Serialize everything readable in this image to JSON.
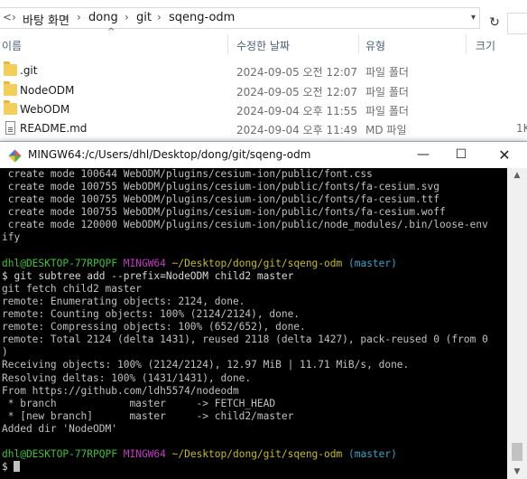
{
  "explorer": {
    "breadcrumb": [
      "바탕 화면",
      "dong",
      "git",
      "sqeng-odm"
    ],
    "columns": {
      "name": "이름",
      "modified": "수정한 날짜",
      "type": "유형",
      "size": "크기"
    },
    "files": [
      {
        "name": ".git",
        "modified": "2024-09-05 오전 12:07",
        "type": "파일 폴더",
        "size": "",
        "icon": "folder-icon"
      },
      {
        "name": "NodeODM",
        "modified": "2024-09-05 오전 12:07",
        "type": "파일 폴더",
        "size": "",
        "icon": "folder-icon"
      },
      {
        "name": "WebODM",
        "modified": "2024-09-04 오후 11:55",
        "type": "파일 폴더",
        "size": "",
        "icon": "folder-icon"
      },
      {
        "name": "README.md",
        "modified": "2024-09-04 오후 11:49",
        "type": "MD 파일",
        "size": "1K",
        "icon": "file-icon"
      }
    ]
  },
  "terminal": {
    "title": "MINGW64:/c/Users/dhl/Desktop/dong/git/sqeng-odm",
    "lines": [
      " create mode 100644 WebODM/plugins/cesium-ion/public/font.css",
      " create mode 100755 WebODM/plugins/cesium-ion/public/fonts/fa-cesium.svg",
      " create mode 100755 WebODM/plugins/cesium-ion/public/fonts/fa-cesium.ttf",
      " create mode 100755 WebODM/plugins/cesium-ion/public/fonts/fa-cesium.woff",
      " create mode 120000 WebODM/plugins/cesium-ion/public/node_modules/.bin/loose-env",
      "ify",
      "",
      "$prompt1",
      "$ git subtree add --prefix=NodeODM child2 master",
      "git fetch child2 master",
      "remote: Enumerating objects: 2124, done.",
      "remote: Counting objects: 100% (2124/2124), done.",
      "remote: Compressing objects: 100% (652/652), done.",
      "remote: Total 2124 (delta 1431), reused 2118 (delta 1427), pack-reused 0 (from 0",
      ")",
      "Receiving objects: 100% (2124/2124), 12.97 MiB | 11.71 MiB/s, done.",
      "Resolving deltas: 100% (1431/1431), done.",
      "From https://github.com/ldh5574/nodeodm",
      " * branch            master     -> FETCH_HEAD",
      " * [new branch]      master     -> child2/master",
      "Added dir 'NodeODM'",
      "",
      "$prompt2",
      "$ "
    ],
    "prompt": {
      "user_host": "dhl@DESKTOP-77RPQPF",
      "shell": "MINGW64",
      "path": "~/Desktop/dong/git/sqeng-odm",
      "branch": "(master)"
    }
  },
  "colors": {
    "prompt_user": "#41c03a",
    "prompt_shell": "#c13ac0",
    "prompt_path": "#c6bb22",
    "prompt_branch": "#3aa3c8",
    "terminal_bg": "#000000"
  }
}
